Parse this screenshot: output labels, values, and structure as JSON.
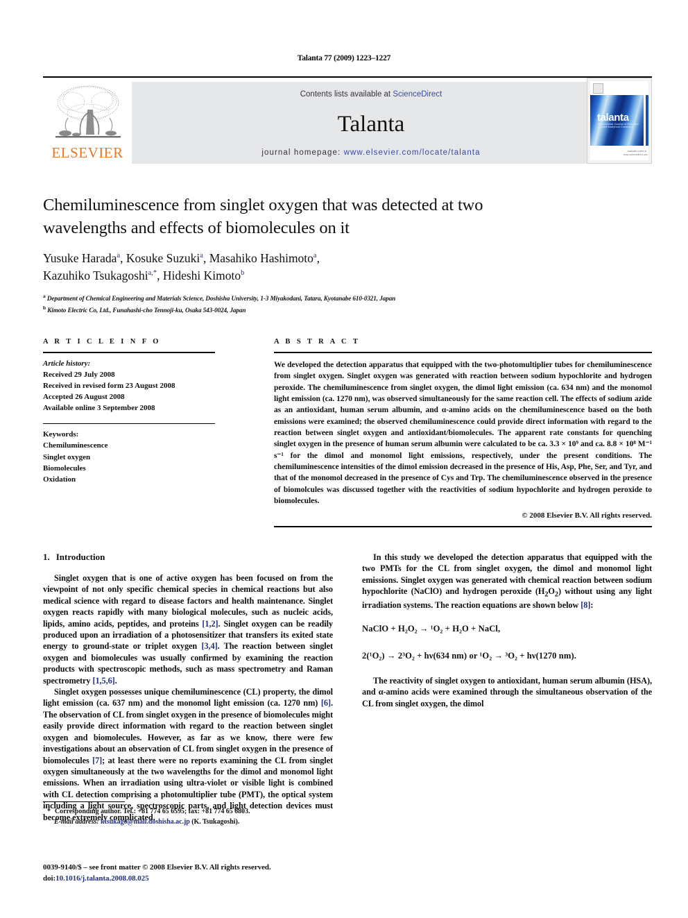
{
  "running_head": "Talanta 77 (2009) 1223–1227",
  "masthead": {
    "publisher_name": "ELSEVIER",
    "contents_prefix": "Contents lists available at ",
    "contents_link": "ScienceDirect",
    "journal_name": "Talanta",
    "homepage_label": "journal homepage: ",
    "homepage_url": "www.elsevier.com/locate/talanta",
    "cover": {
      "wordmark": "talanta",
      "subtitle": "International Journal of Pure and Applied Analytical Chemistry",
      "footer": "Available online at www.sciencedirect.com"
    },
    "colors": {
      "band_background": "#e6e7e9",
      "link_blue": "#3a4aa0",
      "elsevier_orange": "#E87722"
    }
  },
  "article": {
    "title": "Chemiluminescence from singlet oxygen that was detected at two wavelengths and effects of biomolecules on it",
    "authors_line1_name1": "Yusuke Harada",
    "authors_line1_sup1": "a",
    "authors_line1_name2": "Kosuke Suzuki",
    "authors_line1_sup2": "a",
    "authors_line1_name3": "Masahiko Hashimoto",
    "authors_line1_sup3": "a",
    "authors_line2_name1": "Kazuhiko Tsukagoshi",
    "authors_line2_sup1": "a,*",
    "authors_line2_name2": "Hideshi Kimoto",
    "authors_line2_sup2": "b",
    "affiliation_a_marker": "a",
    "affiliation_a": "Department of Chemical Engineering and Materials Science, Doshisha University, 1-3 Miyakodani, Tatara, Kyotanabe 610-0321, Japan",
    "affiliation_b_marker": "b",
    "affiliation_b": "Kimoto Electric Co, Ltd., Funahashi-cho Tennoji-ku, Osaka 543-0024, Japan"
  },
  "article_info": {
    "heading": "A R T I C L E  I N F O",
    "history_label": "Article history:",
    "history": [
      "Received 29 July 2008",
      "Received in revised form 23 August 2008",
      "Accepted 26 August 2008",
      "Available online 3 September 2008"
    ],
    "keywords_label": "Keywords:",
    "keywords": [
      "Chemiluminescence",
      "Singlet oxygen",
      "Biomolecules",
      "Oxidation"
    ]
  },
  "abstract": {
    "heading": "A B S T R A C T",
    "text": "We developed the detection apparatus that equipped with the two-photomultiplier tubes for chemiluminescence from singlet oxygen. Singlet oxygen was generated with reaction between sodium hypochlorite and hydrogen peroxide. The chemiluminescence from singlet oxygen, the dimol light emission (ca. 634 nm) and the monomol light emission (ca. 1270 nm), was observed simultaneously for the same reaction cell. The effects of sodium azide as an antioxidant, human serum albumin, and α-amino acids on the chemiluminescence based on the both emissions were examined; the observed chemiluminescence could provide direct information with regard to the reaction between singlet oxygen and antioxidant/biomolecules. The apparent rate constants for quenching singlet oxygen in the presence of human serum albumin were calculated to be ca. 3.3 × 10⁹ and ca. 8.8 × 10⁸ M⁻¹ s⁻¹ for the dimol and monomol light emissions, respectively, under the present conditions. The chemiluminescence intensities of the dimol emission decreased in the presence of His, Asp, Phe, Ser, and Tyr, and that of the monomol decreased in the presence of Cys and Trp. The chemiluminescence observed in the presence of biomolcules was discussed together with the reactivities of sodium hypochlorite and hydrogen peroxide to biomolecules.",
    "copyright": "© 2008 Elsevier B.V. All rights reserved."
  },
  "introduction": {
    "section_number": "1.",
    "section_title": "Introduction",
    "para1_a": "Singlet oxygen that is one of active oxygen has been focused on from the viewpoint of not only specific chemical species in chemical reactions but also medical science with regard to disease factors and health maintenance. Singlet oxygen reacts rapidly with many biological molecules, such as nucleic acids, lipids, amino acids, peptides, and proteins ",
    "para1_ref1": "[1,2]",
    "para1_b": ". Singlet oxygen can be readily produced upon an irradiation of a photosensitizer that transfers its exited state energy to ground-state or triplet oxygen ",
    "para1_ref2": "[3,4]",
    "para1_c": ". The reaction between singlet oxygen and biomolecules was usually confirmed by examining the reaction products with spectroscopic methods, such as mass spectrometry and Raman spectrometry ",
    "para1_ref3": "[1,5,6]",
    "para1_d": ".",
    "para2_a": "Singlet oxygen possesses unique chemiluminescence (CL) property, the dimol light emission (ca. 637 nm) and the monomol light emission (ca. 1270 nm) ",
    "para2_ref1": "[6]",
    "para2_b": ". The observation of CL from singlet oxygen in the presence of biomolecules might easily provide direct information with regard to the reaction between singlet oxygen and biomolecules. However, as far as we know, there were few investigations about an observation of CL from singlet oxygen in the presence of biomolecules ",
    "para2_ref2": "[7]",
    "para2_c": "; at least there were no reports examining the CL from singlet oxygen simultaneously at the two wavelengths for the dimol and monomol light emissions. When an irradiation using ultra-violet or visible light is combined with CL detection comprising a photomultiplier tube (PMT), the optical system including a light source, spectroscopic parts, and light detection devices must become extremely complicated.",
    "para3_a": "In this study we developed the detection apparatus that equipped with the two PMTs for the CL from singlet oxygen, the dimol and monomol light emissions. Singlet oxygen was generated with chemical reaction between sodium hypochlorite (NaClO) and hydrogen peroxide (H",
    "para3_sub1": "2",
    "para3_b": "O",
    "para3_sub2": "2",
    "para3_c": ") without using any light irradiation systems. The reaction equations are shown below ",
    "para3_ref1": "[8]",
    "para3_d": ":",
    "equation1": "NaClO + H₂O₂ → ¹O₂ + H₂O + NaCl,",
    "equation2": "2(¹O₂) → 2³O₂ + hν(634 nm) or  ¹O₂ → ³O₂ + hν(1270 nm).",
    "para4": "The reactivity of singlet oxygen to antioxidant, human serum albumin (HSA), and α-amino acids were examined through the simultaneous observation of the CL from singlet oxygen, the dimol"
  },
  "footnotes": {
    "corresponding_marker": "*",
    "corresponding_text": "Corresponding author. Tel.: +81 774 65 6595; fax: +81 774 65 6803.",
    "email_label": "E-mail address:",
    "email": "ktsukago@mail.doshisha.ac.jp",
    "email_owner": "(K. Tsukagoshi)."
  },
  "footer": {
    "issn_line": "0039-9140/$ – see front matter © 2008 Elsevier B.V. All rights reserved.",
    "doi_label": "doi:",
    "doi_value": "10.1016/j.talanta.2008.08.025"
  }
}
